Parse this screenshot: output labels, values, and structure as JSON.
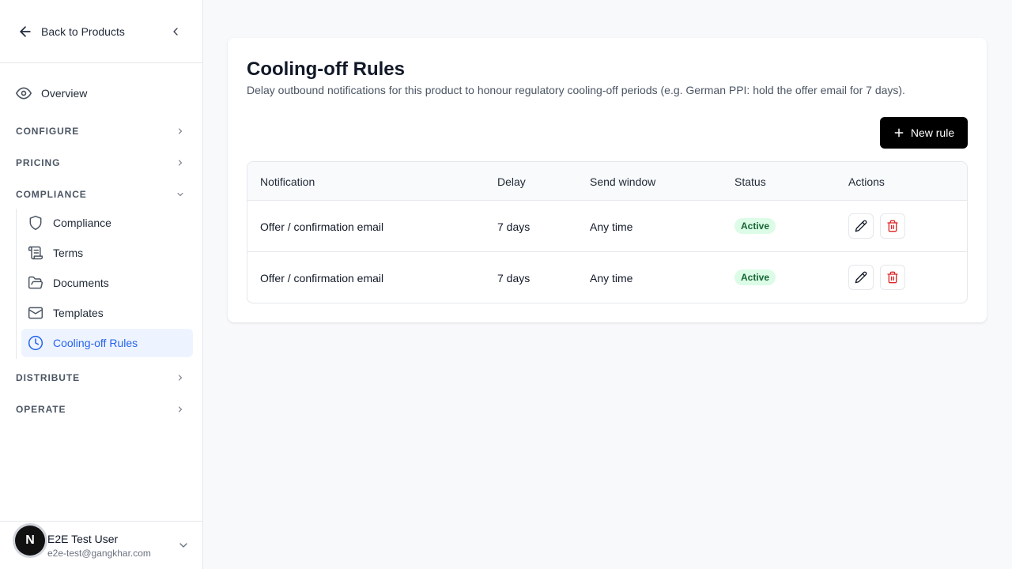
{
  "sidebar": {
    "back_label": "Back to Products",
    "overview_label": "Overview",
    "sections": {
      "configure": "CONFIGURE",
      "pricing": "PRICING",
      "compliance": "COMPLIANCE",
      "distribute": "DISTRIBUTE",
      "operate": "OPERATE"
    },
    "compliance_items": [
      {
        "label": "Compliance",
        "icon": "shield-icon"
      },
      {
        "label": "Terms",
        "icon": "scroll-icon"
      },
      {
        "label": "Documents",
        "icon": "folder-icon"
      },
      {
        "label": "Templates",
        "icon": "mail-icon"
      },
      {
        "label": "Cooling-off Rules",
        "icon": "clock-icon",
        "active": true
      }
    ],
    "user": {
      "initial": "N",
      "name": "E2E Test User",
      "email": "e2e-test@gangkhar.com"
    }
  },
  "page": {
    "title": "Cooling-off Rules",
    "description": "Delay outbound notifications for this product to honour regulatory cooling-off periods (e.g. German PPI: hold the offer email for 7 days).",
    "new_button_label": "New rule"
  },
  "table": {
    "headers": {
      "notification": "Notification",
      "delay": "Delay",
      "send_window": "Send window",
      "status": "Status",
      "actions": "Actions"
    },
    "rows": [
      {
        "notification": "Offer / confirmation email",
        "delay": "7 days",
        "send_window": "Any time",
        "status": "Active"
      },
      {
        "notification": "Offer / confirmation email",
        "delay": "7 days",
        "send_window": "Any time",
        "status": "Active"
      }
    ]
  },
  "colors": {
    "accent": "#2563eb",
    "active_bg": "#eef4ff",
    "badge_bg": "#dcfce7",
    "badge_text": "#166534",
    "delete": "#dc2626",
    "primary_button": "#000000"
  }
}
